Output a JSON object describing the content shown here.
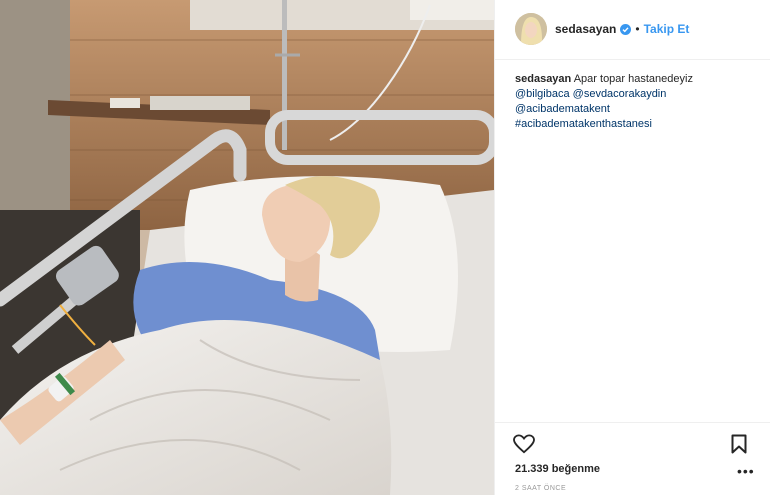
{
  "post": {
    "username": "sedasayan",
    "verified": true,
    "separator": "•",
    "follow_label": "Takip Et"
  },
  "caption": {
    "username": "sedasayan",
    "text": "Apar topar hastanedeyiz",
    "mention_1": "@bilgibaca",
    "mention_2": "@sevdacorakaydin",
    "mention_3": "@acibadematakent",
    "hashtag": "#acibadematakenthastanesi"
  },
  "stats": {
    "likes": "21.339 beğenme",
    "time": "2 SAAT ÖNCE"
  },
  "icons": {
    "like": "heart-icon",
    "save": "bookmark-icon",
    "more": "more-options-icon",
    "verified": "verified-badge-icon"
  },
  "colors": {
    "link": "#003569",
    "accent": "#3897f0",
    "text": "#262626",
    "muted": "#999999"
  }
}
